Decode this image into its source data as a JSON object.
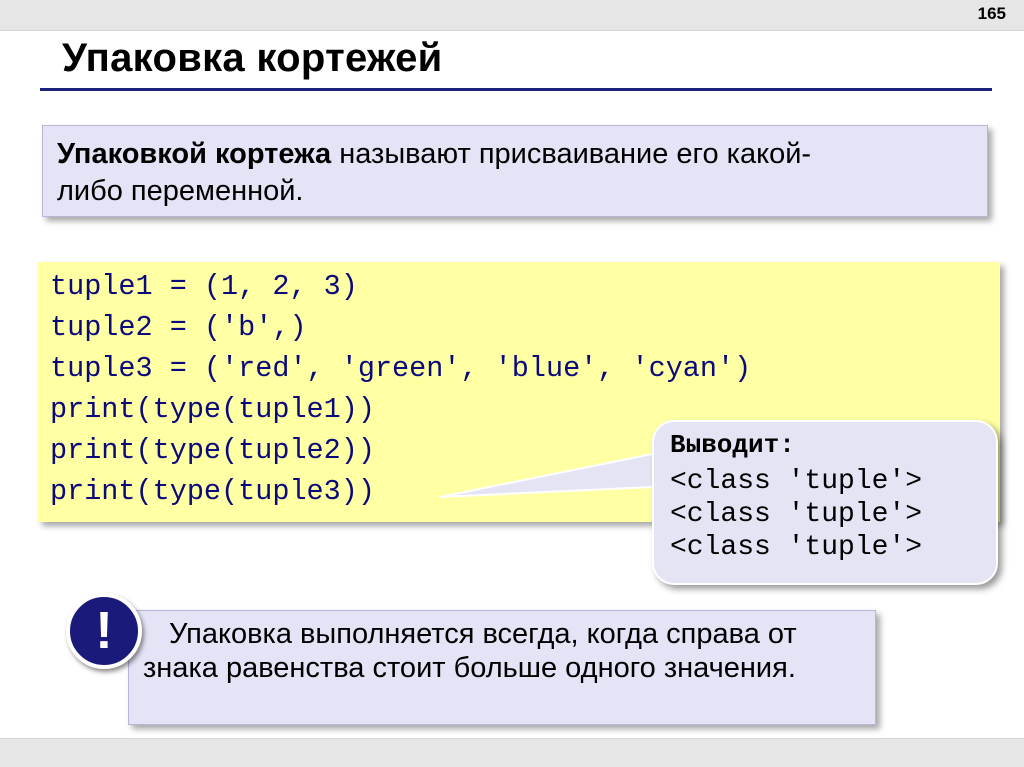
{
  "page": {
    "number": "165",
    "title": "Упаковка кортежей"
  },
  "definition": {
    "term": "Упаковкой кортежа",
    "text_line1": " называют присваивание его какой-",
    "text_line2": "либо переменной."
  },
  "code": {
    "lines": [
      "tuple1 = (1, 2, 3)",
      "tuple2 = ('b',)",
      "tuple3 = ('red', 'green', 'blue', 'cyan')",
      "print(type(tuple1))",
      "print(type(tuple2))",
      "print(type(tuple3))"
    ]
  },
  "output_callout": {
    "heading": "Выводит:",
    "lines": [
      "<class 'tuple'>",
      "<class 'tuple'>",
      "<class 'tuple'>"
    ]
  },
  "note": {
    "icon": "exclamation-icon",
    "icon_symbol": "!",
    "text": "Упаковка выполняется всегда, когда справа от знака равенства стоит больше одного значения."
  },
  "colors": {
    "title_rule": "#1a237e",
    "definition_bg": "#e4e4f6",
    "code_bg": "#ffffa4",
    "code_text": "#0a0a7a",
    "alert_bg": "#1a1a7a"
  }
}
